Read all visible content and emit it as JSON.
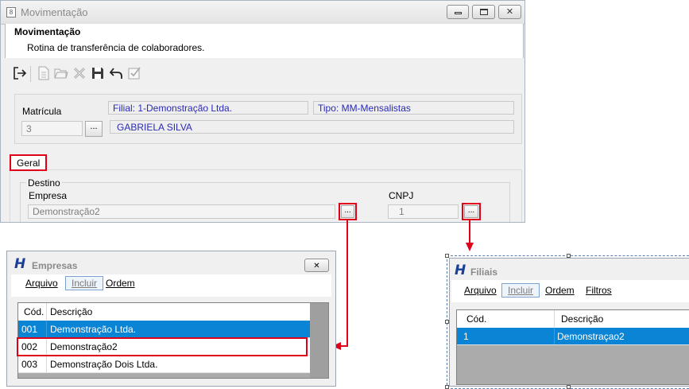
{
  "window": {
    "title": "Movimentação",
    "min_label": "",
    "max_label": "",
    "close_symbol": "✕",
    "app_icon": "app-icon"
  },
  "header": {
    "title": "Movimentação",
    "subtitle": "Rotina de transferência de colaboradores."
  },
  "toolbar": {
    "items": [
      "exit-icon",
      "new-icon",
      "open-icon",
      "delete-icon",
      "save-icon",
      "undo-icon",
      "confirm-icon"
    ]
  },
  "form": {
    "matricula_label": "Matrícula",
    "matricula_value": "3",
    "ellipsis": "...",
    "filial": "Filial: 1-Demonstração Ltda.",
    "tipo": "Tipo: MM-Mensalistas",
    "nome": "GABRIELA SILVA"
  },
  "tabs": {
    "geral": "Geral"
  },
  "destino": {
    "group_label": "Destino",
    "empresa_label": "Empresa",
    "empresa_value": "Demonstração2",
    "cnpj_label": "CNPJ",
    "cnpj_value": "1",
    "ellipsis": "..."
  },
  "empresas_dialog": {
    "title": "Empresas",
    "close_symbol": "✕",
    "menu": [
      "Arquivo",
      "Incluir",
      "Ordem"
    ],
    "columns": [
      "Cód.",
      "Descrição"
    ],
    "rows": [
      {
        "cod": "001",
        "descricao": "Demonstração Ltda."
      },
      {
        "cod": "002",
        "descricao": "Demonstração2"
      },
      {
        "cod": "003",
        "descricao": "Demonstração Dois Ltda."
      }
    ]
  },
  "filiais_dialog": {
    "title": "Filiais",
    "menu": [
      "Arquivo",
      "Incluir",
      "Ordem",
      "Filtros"
    ],
    "columns": [
      "Cód.",
      "Descrição"
    ],
    "rows": [
      {
        "cod": "1",
        "descricao": "Demonstraçao2"
      }
    ]
  },
  "colors": {
    "highlight_red": "#e0001a",
    "selection_blue": "#0a85d6",
    "link_blue": "#2929b8"
  }
}
